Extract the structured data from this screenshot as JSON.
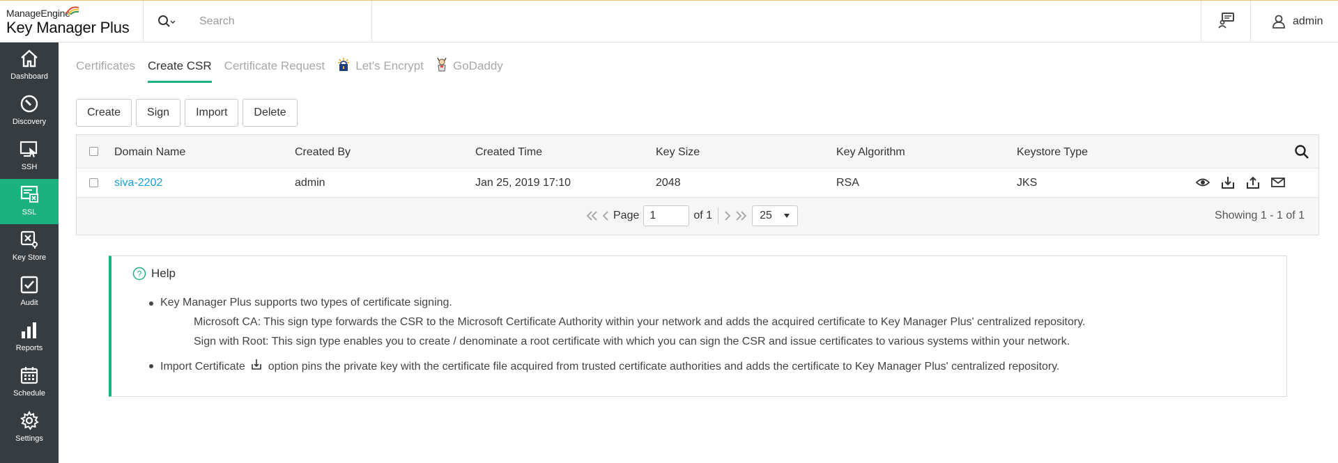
{
  "header": {
    "brand": "ManageEngine",
    "product": "Key Manager Plus",
    "search_placeholder": "Search",
    "user_name": "admin"
  },
  "sidebar": {
    "items": [
      {
        "label": "Dashboard",
        "icon": "home-icon"
      },
      {
        "label": "Discovery",
        "icon": "discovery-icon"
      },
      {
        "label": "SSH",
        "icon": "ssh-icon"
      },
      {
        "label": "SSL",
        "icon": "ssl-icon",
        "active": true
      },
      {
        "label": "Key Store",
        "icon": "key-store-icon"
      },
      {
        "label": "Audit",
        "icon": "audit-icon"
      },
      {
        "label": "Reports",
        "icon": "reports-icon"
      },
      {
        "label": "Schedule",
        "icon": "schedule-icon"
      },
      {
        "label": "Settings",
        "icon": "settings-icon"
      }
    ]
  },
  "tabs": [
    {
      "label": "Certificates"
    },
    {
      "label": "Create CSR",
      "active": true
    },
    {
      "label": "Certificate Request"
    },
    {
      "label": "Let's Encrypt",
      "icon": "lets-encrypt-icon"
    },
    {
      "label": "GoDaddy",
      "icon": "godaddy-icon"
    }
  ],
  "actions": {
    "create": "Create",
    "sign": "Sign",
    "import": "Import",
    "delete": "Delete"
  },
  "table": {
    "columns": [
      "Domain Name",
      "Created By",
      "Created Time",
      "Key Size",
      "Key Algorithm",
      "Keystore Type"
    ],
    "rows": [
      {
        "domain": "siva-2202",
        "created_by": "admin",
        "created_time": "Jan 25, 2019 17:10",
        "key_size": "2048",
        "key_algorithm": "RSA",
        "keystore_type": "JKS"
      }
    ],
    "row_action_icons": [
      "view-icon",
      "download-icon",
      "export-icon",
      "mail-icon"
    ]
  },
  "pagination": {
    "page_label": "Page",
    "page_value": "1",
    "of_label": "of 1",
    "page_size": "25",
    "showing": "Showing 1 - 1 of 1"
  },
  "help": {
    "title": "Help",
    "item1": "Key Manager Plus supports two types of certificate signing.",
    "sub1": "Microsoft CA: This sign type forwards the CSR to the Microsoft Certificate Authority within your network and adds the acquired certificate to Key Manager Plus' centralized repository.",
    "sub2": "Sign with Root: This sign type enables you to create / denominate a root certificate with which you can sign the CSR and issue certificates to various systems within your network.",
    "item2_before": "Import Certificate",
    "item2_after": "option pins the private key with the certificate file acquired from trusted certificate authorities and adds the certificate to Key Manager Plus' centralized repository."
  },
  "colors": {
    "accent": "#1bb27f",
    "sidebar_bg": "#363c40",
    "link": "#1aa0d8"
  }
}
